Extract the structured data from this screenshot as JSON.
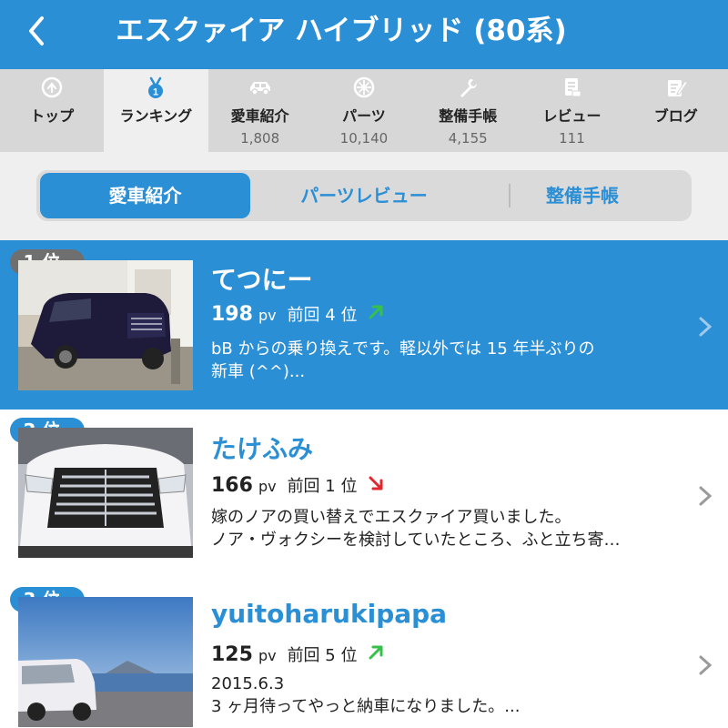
{
  "header": {
    "title": "エスクァイア ハイブリッド (80系)",
    "back_icon": "back-chevron-icon"
  },
  "tabs": [
    {
      "label": "トップ",
      "count": "",
      "icon": "home-icon"
    },
    {
      "label": "ランキング",
      "count": "",
      "icon": "medal-icon",
      "active": true
    },
    {
      "label": "愛車紹介",
      "count": "1,808",
      "icon": "car-icon"
    },
    {
      "label": "パーツ",
      "count": "10,140",
      "icon": "wheel-icon"
    },
    {
      "label": "整備手帳",
      "count": "4,155",
      "icon": "wrench-icon"
    },
    {
      "label": "レビュー",
      "count": "111",
      "icon": "review-icon"
    },
    {
      "label": "ブログ",
      "count": "",
      "icon": "blog-icon"
    }
  ],
  "segments": [
    {
      "label": "愛車紹介",
      "active": true
    },
    {
      "label": "パーツレビュー"
    },
    {
      "label": "整備手帳"
    }
  ],
  "ranking": [
    {
      "rank": "1 位",
      "name": "てつにー",
      "pv": "198",
      "pv_unit": "pv",
      "prev": "前回 4 位",
      "trend": "up",
      "desc1": "bB からの乗り換えです。軽以外では 15 年半ぶりの",
      "desc2": "新車 (^^)..."
    },
    {
      "rank": "2 位",
      "name": "たけふみ",
      "pv": "166",
      "pv_unit": "pv",
      "prev": "前回 1 位",
      "trend": "down",
      "desc1": "嫁のノアの買い替えでエスクァイア買いました。",
      "desc2": "ノア・ヴォクシーを検討していたところ、ふと立ち寄…"
    },
    {
      "rank": "3 位",
      "name": "yuitoharukipapa",
      "pv": "125",
      "pv_unit": "pv",
      "prev": "前回 5 位",
      "trend": "up",
      "desc1": "2015.6.3",
      "desc2": "3 ヶ月待ってやっと納車になりました。..."
    }
  ],
  "colors": {
    "accent": "#2b8fd6",
    "up": "#35c04a",
    "down": "#e0262e"
  }
}
